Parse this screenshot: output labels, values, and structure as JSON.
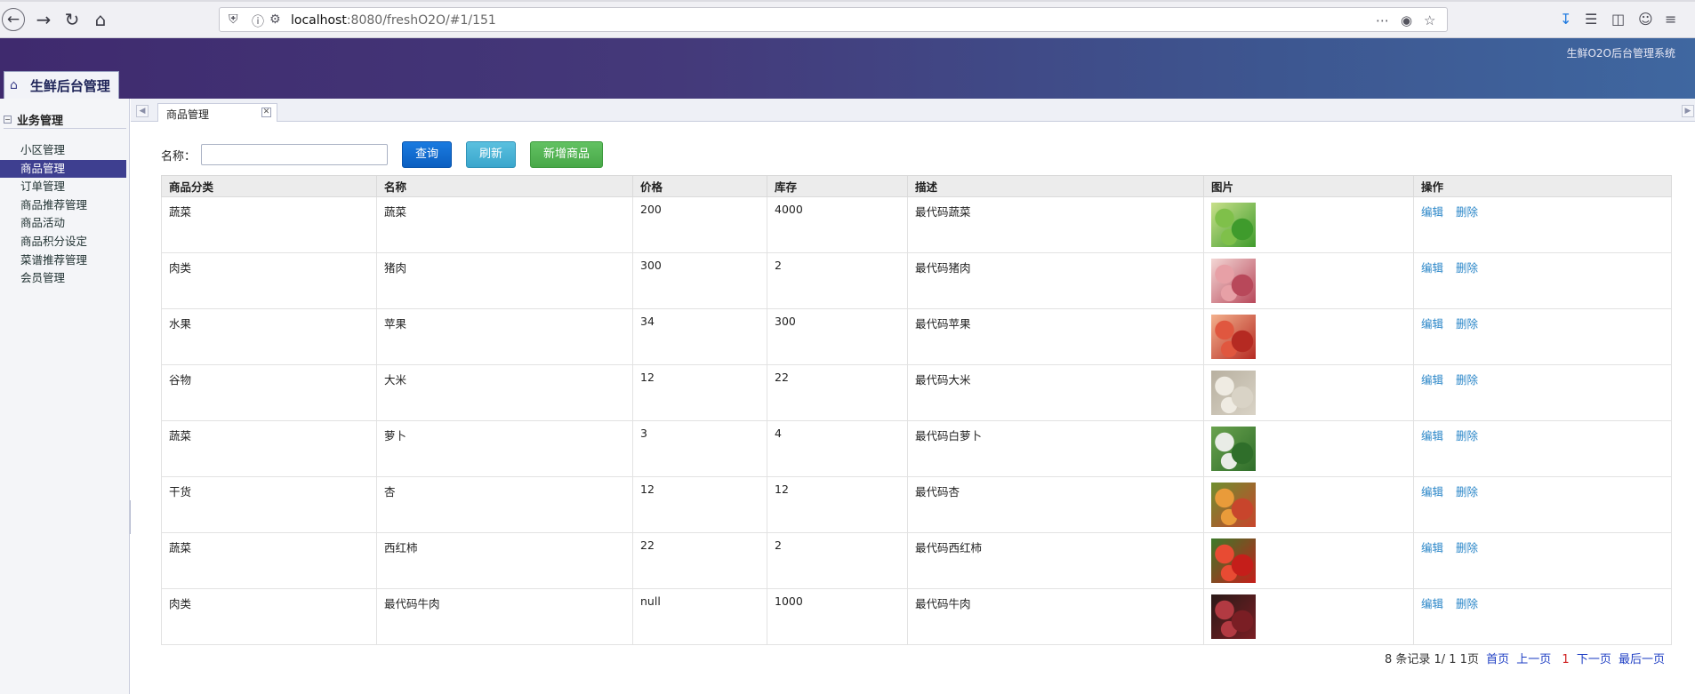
{
  "browser": {
    "url_host": "localhost",
    "url_rest": ":8080/freshO2O/#1/151"
  },
  "header": {
    "system_title": "生鲜O2O后台管理系统",
    "brand": "生鲜后台管理"
  },
  "sidebar": {
    "group_label": "业务管理",
    "items": [
      {
        "label": "小区管理",
        "active": false
      },
      {
        "label": "商品管理",
        "active": true
      },
      {
        "label": "订单管理",
        "active": false
      },
      {
        "label": "商品推荐管理",
        "active": false
      },
      {
        "label": "商品活动",
        "active": false
      },
      {
        "label": "商品积分设定",
        "active": false
      },
      {
        "label": "菜谱推荐管理",
        "active": false
      },
      {
        "label": "会员管理",
        "active": false
      }
    ]
  },
  "tab": {
    "label": "商品管理"
  },
  "search": {
    "label": "名称：",
    "value": "",
    "query_label": "查询",
    "refresh_label": "刷新",
    "add_label": "新增商品"
  },
  "table": {
    "columns": [
      "商品分类",
      "名称",
      "价格",
      "库存",
      "描述",
      "图片",
      "操作"
    ],
    "edit_label": "编辑",
    "delete_label": "删除",
    "rows": [
      {
        "category": "蔬菜",
        "name": "蔬菜",
        "price": "200",
        "stock": "4000",
        "desc": "最代码蔬菜",
        "image": "vegetables",
        "colors": [
          "#3f9b2c",
          "#7fc04a",
          "#c8e08a"
        ]
      },
      {
        "category": "肉类",
        "name": "猪肉",
        "price": "300",
        "stock": "2",
        "desc": "最代码猪肉",
        "image": "pork",
        "colors": [
          "#b8485a",
          "#e7a0a6",
          "#f3d6d4"
        ]
      },
      {
        "category": "水果",
        "name": "苹果",
        "price": "34",
        "stock": "300",
        "desc": "最代码苹果",
        "image": "apples",
        "colors": [
          "#b52a22",
          "#e0573f",
          "#f3b08c"
        ]
      },
      {
        "category": "谷物",
        "name": "大米",
        "price": "12",
        "stock": "22",
        "desc": "最代码大米",
        "image": "rice",
        "colors": [
          "#d9d3c6",
          "#efebe2",
          "#b8b0a0"
        ]
      },
      {
        "category": "蔬菜",
        "name": "萝卜",
        "price": "3",
        "stock": "4",
        "desc": "最代码白萝卜",
        "image": "radish",
        "colors": [
          "#2f6e2a",
          "#e9ece6",
          "#6aa24e"
        ]
      },
      {
        "category": "干货",
        "name": "杏",
        "price": "12",
        "stock": "12",
        "desc": "最代码杏",
        "image": "apricot",
        "colors": [
          "#c8452c",
          "#e99b3a",
          "#6e8f2e"
        ]
      },
      {
        "category": "蔬菜",
        "name": "西红柿",
        "price": "22",
        "stock": "2",
        "desc": "最代码西红柿",
        "image": "tomato",
        "colors": [
          "#c51e1a",
          "#e84b33",
          "#3c7a2a"
        ]
      },
      {
        "category": "肉类",
        "name": "最代码牛肉",
        "price": "null",
        "stock": "1000",
        "desc": "最代码牛肉",
        "image": "beef",
        "colors": [
          "#7a1e24",
          "#b23a42",
          "#2a1a18"
        ]
      }
    ]
  },
  "pager": {
    "summary": "8 条记录 1/ 1 1页",
    "first": "首页",
    "prev": "上一页",
    "current": "1",
    "next": "下一页",
    "last": "最后一页"
  }
}
